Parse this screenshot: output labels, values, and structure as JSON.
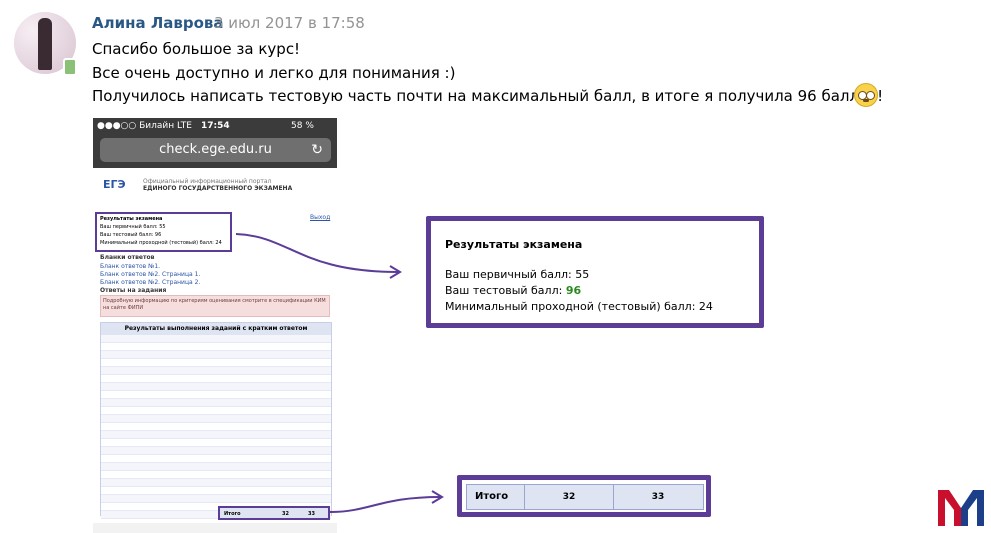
{
  "post": {
    "author": "Алина Лаврова",
    "date": "3 июл 2017 в 17:58",
    "lines": [
      "Спасибо большое за курс!",
      "Все очень доступно и легко для понимания :)",
      "Получилось написать тестовую часть почти на максимальный балл, в итоге я получила 96 баллов!"
    ]
  },
  "phone": {
    "carrier": "●●●○○ Билайн  LTE",
    "time": "17:54",
    "battery": "58 %",
    "url": "check.ege.edu.ru",
    "logo": "ЕГЭ",
    "portal_line1": "Официальный информационный портал",
    "portal_line2": "ЕДИНОГО ГОСУДАРСТВЕННОГО ЭКЗАМЕНА",
    "exit": "Выход",
    "mini_title": "Результаты экзамена",
    "mini_primary": "Ваш первичный балл: 55",
    "mini_test": "Ваш тестовый балл: 96",
    "mini_min": "Минимальный проходной (тестовый) балл: 24",
    "blanks_header": "Бланки ответов",
    "blank1": "Бланк ответов №1.",
    "blank2": "Бланк ответов №2. Страница 1.",
    "blank3": "Бланк ответов №2. Страница 2.",
    "answers_header": "Ответы на задания",
    "alert_text": "Подробную информацию по критериям оценивания смотрите в спецификации КИМ на сайте ФИПИ",
    "table_title": "Результаты выполнения заданий с кратким ответом",
    "itogo": "Итого",
    "itogo_a": "32",
    "itogo_b": "33"
  },
  "result": {
    "title": "Результаты экзамена",
    "primary": "Ваш первичный балл: 55",
    "test_label": "Ваш тестовый балл: ",
    "test_value": "96",
    "min": "Минимальный проходной (тестовый) балл: 24"
  },
  "total": {
    "label": "Итого",
    "a": "32",
    "b": "33"
  },
  "colors": {
    "accent": "#5b3c97",
    "link": "#2a5885",
    "logo_red": "#c8102e",
    "logo_blue": "#1d3f8a"
  }
}
